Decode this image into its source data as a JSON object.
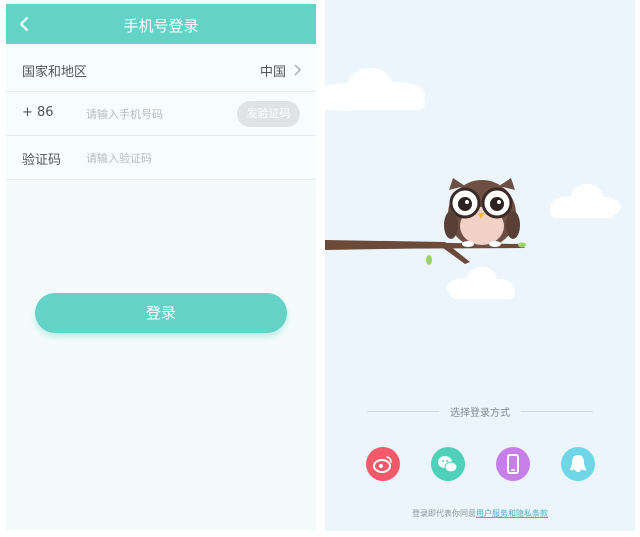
{
  "header": {
    "title": "手机号登录"
  },
  "form": {
    "region_label": "国家和地区",
    "region_value": "中国",
    "phone_prefix": "+ 86",
    "phone_placeholder": "请输入手机号码",
    "send_code_label": "发验证码",
    "code_label": "验证码",
    "code_placeholder": "请输入验证码",
    "login_label": "登录"
  },
  "social": {
    "divider_text": "选择登录方式",
    "options": [
      {
        "icon": "weibo-icon",
        "color": "#f25a6b"
      },
      {
        "icon": "wechat-icon",
        "color": "#4fd0b8"
      },
      {
        "icon": "phone-icon",
        "color": "#c87ee8"
      },
      {
        "icon": "qq-icon",
        "color": "#6fd6e8"
      }
    ]
  },
  "agreement": {
    "prefix": "登录即代表你同意",
    "link": "用户服务和隐私条款"
  },
  "colors": {
    "accent": "#62d3c6",
    "background": "#ebf5fb"
  }
}
